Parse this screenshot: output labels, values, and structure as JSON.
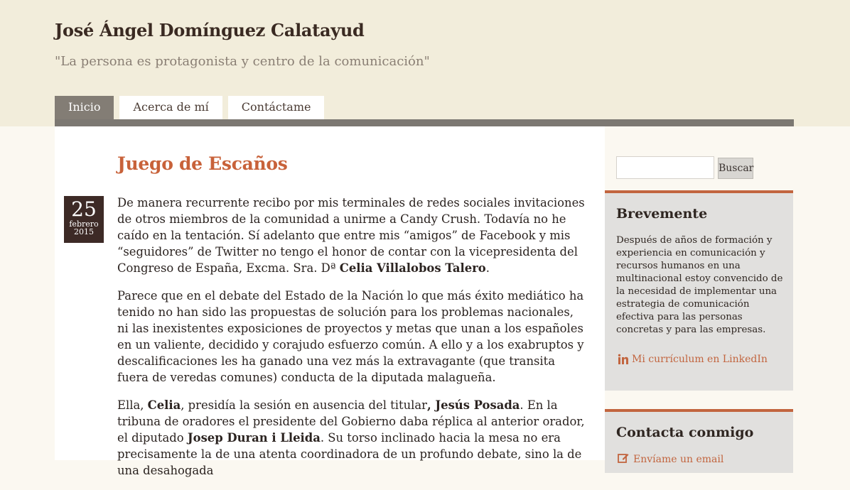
{
  "site": {
    "title": "José Ángel Domínguez Calatayud",
    "tagline": "\"La persona es protagonista y centro de la comunicación\""
  },
  "nav": {
    "items": [
      {
        "label": "Inicio",
        "active": true
      },
      {
        "label": "Acerca de mí",
        "active": false
      },
      {
        "label": "Contáctame",
        "active": false
      }
    ]
  },
  "post": {
    "title": "Juego de Escaños",
    "date": {
      "day": "25",
      "month": "febrero",
      "year": "2015"
    },
    "p1": {
      "t1": "De manera recurrente recibo por mis terminales de redes sociales invitaciones de otros miembros de la comunidad a unirme a Candy Crush. Todavía no he caído en la tentación. Sí adelanto que entre mis “amigos” de Facebook y mis “seguidores” de Twitter no tengo el honor de contar con la vicepresidenta del Congreso de España, Excma. Sra. Dª ",
      "b1": "Celia Villalobos Talero",
      "t2": "."
    },
    "p2": "Parece que en el debate del Estado de la Nación lo que más éxito mediático ha tenido no han sido las propuestas de solución para los problemas nacionales, ni las inexistentes exposiciones de proyectos y metas que unan a los españoles en un valiente, decidido y corajudo esfuerzo común. A ello y a los exabruptos y descalificaciones les ha ganado una vez más la extravagante (que transita fuera de veredas comunes) conducta de la diputada malagueña.",
    "p3": {
      "t1": "Ella, ",
      "b1": "Celia",
      "t2": ", presidía la sesión en ausencia del titular",
      "b2": ", Jesús Posada",
      "t3": ". En la tribuna de oradores el presidente del Gobierno daba réplica al anterior orador, el diputado ",
      "b3": "Josep Duran i Lleida",
      "t4": ". Su torso inclinado hacia la mesa no era precisamente la de una atenta coordinadora de un profundo debate, sino la de una desahogada"
    }
  },
  "sidebar": {
    "search": {
      "placeholder": "",
      "button_label": "Buscar"
    },
    "about": {
      "title": "Brevemente",
      "text": "Después de años de formación y experiencia en comunicación y recursos humanos en una multinacional estoy convencido de la necesidad de implementar una estrategia de comunicación efectiva para las personas concretas y para las empresas.",
      "linkedin_label": "Mi currículum en LinkedIn"
    },
    "contact": {
      "title": "Contacta conmigo",
      "link_label": "Envíame un email"
    }
  },
  "colors": {
    "accent": "#c8623a",
    "header_bg": "#f2eddb",
    "nav_active": "#837d75",
    "date_box": "#3d2a26",
    "widget_bg": "#e1e0de"
  },
  "icons": {
    "linkedin": "linkedin-icon",
    "email": "email-edit-icon"
  }
}
